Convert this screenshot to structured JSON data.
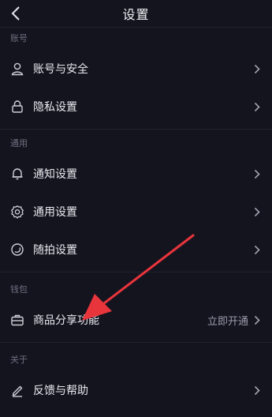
{
  "header": {
    "title": "设置"
  },
  "sections": {
    "account": {
      "title": "账号",
      "items": [
        {
          "label": "账号与安全",
          "icon": "user-icon"
        },
        {
          "label": "隐私设置",
          "icon": "lock-icon"
        }
      ]
    },
    "general": {
      "title": "通用",
      "items": [
        {
          "label": "通知设置",
          "icon": "bell-icon"
        },
        {
          "label": "通用设置",
          "icon": "gear-icon"
        },
        {
          "label": "随拍设置",
          "icon": "snap-icon"
        }
      ]
    },
    "wallet": {
      "title": "钱包",
      "items": [
        {
          "label": "商品分享功能",
          "icon": "briefcase-icon",
          "aside": "立即开通"
        }
      ]
    },
    "about": {
      "title": "关于",
      "items": [
        {
          "label": "反馈与帮助",
          "icon": "edit-icon"
        }
      ]
    }
  },
  "colors": {
    "background": "#14141f",
    "annotation_arrow": "#e8343b"
  }
}
